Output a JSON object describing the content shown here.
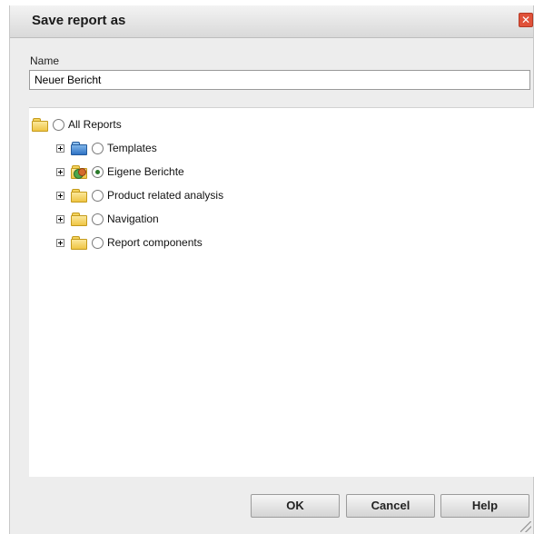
{
  "dialog": {
    "title": "Save report as",
    "close_icon": "close-icon"
  },
  "name_field": {
    "label": "Name",
    "value": "Neuer Bericht"
  },
  "tree": {
    "root": {
      "label": "All Reports",
      "icon": "folder-icon",
      "checked": false
    },
    "items": [
      {
        "label": "Templates",
        "icon": "folder-blue-icon",
        "checked": false
      },
      {
        "label": "Eigene Berichte",
        "icon": "folder-users-icon",
        "checked": true
      },
      {
        "label": "Product related analysis",
        "icon": "folder-icon",
        "checked": false
      },
      {
        "label": "Navigation",
        "icon": "folder-icon",
        "checked": false
      },
      {
        "label": "Report components",
        "icon": "folder-icon",
        "checked": false
      }
    ]
  },
  "buttons": {
    "ok": "OK",
    "cancel": "Cancel",
    "help": "Help"
  },
  "colors": {
    "dialog_background": "#ededed",
    "close_button": "#e0523a"
  }
}
